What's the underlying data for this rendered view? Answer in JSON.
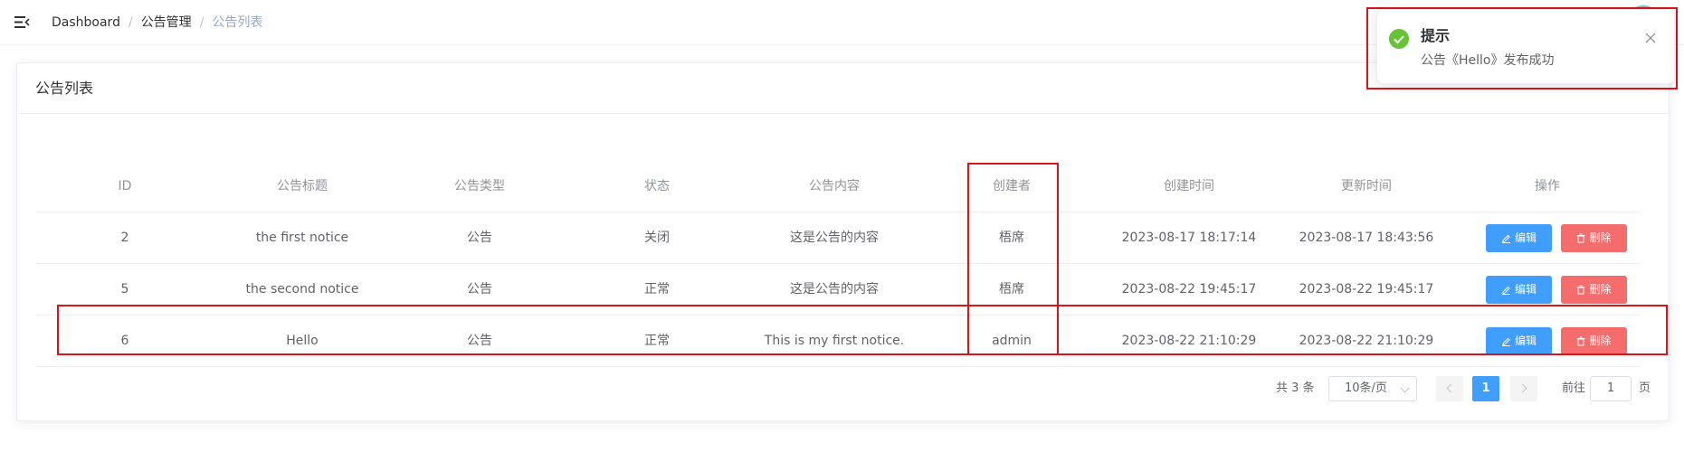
{
  "breadcrumb": [
    "Dashboard",
    "公告管理",
    "公告列表"
  ],
  "card": {
    "title": "公告列表"
  },
  "table": {
    "headers": [
      "ID",
      "公告标题",
      "公告类型",
      "状态",
      "公告内容",
      "创建者",
      "创建时间",
      "更新时间",
      "操作"
    ],
    "rows": [
      {
        "id": "2",
        "title": "the first notice",
        "type": "公告",
        "status": "关闭",
        "content": "这是公告的内容",
        "creator": "梧席",
        "created": "2023-08-17 18:17:14",
        "updated": "2023-08-17 18:43:56"
      },
      {
        "id": "5",
        "title": "the second notice",
        "type": "公告",
        "status": "正常",
        "content": "这是公告的内容",
        "creator": "梧席",
        "created": "2023-08-22 19:45:17",
        "updated": "2023-08-22 19:45:17"
      },
      {
        "id": "6",
        "title": "Hello",
        "type": "公告",
        "status": "正常",
        "content": "This is my first notice.",
        "creator": "admin",
        "created": "2023-08-22 21:10:29",
        "updated": "2023-08-22 21:10:29"
      }
    ],
    "edit_label": "编辑",
    "delete_label": "删除"
  },
  "pagination": {
    "total": "共 3 条",
    "page_size": "10条/页",
    "current_page": "1",
    "goto_label": "前往",
    "goto_value": "1",
    "goto_suffix": "页"
  },
  "notification": {
    "title": "提示",
    "message": "公告《Hello》发布成功"
  },
  "colors": {
    "primary": "#409eff",
    "danger": "#f56c6c",
    "success": "#67c23a",
    "annotation": "#d9141c"
  }
}
